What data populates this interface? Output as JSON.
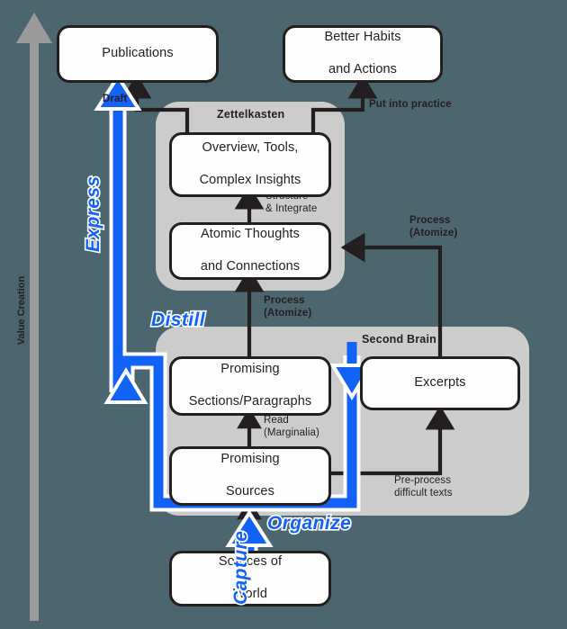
{
  "diagram": {
    "title": "Value Creation / Second Brain & Zettelkasten workflow",
    "background_color": "#4c6670",
    "panel_color": "#cccccc",
    "node_fill": "#fdfdfd",
    "stroke_color": "#231f20",
    "accent_blue": "#1162f5",
    "axis_gray": "#999999"
  },
  "axis": {
    "label": "Value Creation",
    "direction": "up"
  },
  "nodes": {
    "publications": {
      "label": "Publications"
    },
    "better_habits": {
      "line1": "Better Habits",
      "line2": "and Actions"
    },
    "overview_tools": {
      "line1": "Overview, Tools,",
      "line2": "Complex Insights"
    },
    "atomic_thoughts": {
      "line1": "Atomic Thoughts",
      "line2": "and Connections"
    },
    "promising_sections": {
      "line1": "Promising",
      "line2": "Sections/Paragraphs"
    },
    "promising_sources": {
      "line1": "Promising",
      "line2": "Sources"
    },
    "excerpts": {
      "label": "Excerpts"
    },
    "sources_of_world": {
      "line1": "Sources of",
      "line2": "World"
    }
  },
  "panels": {
    "zettelkasten": {
      "title": "Zettelkasten"
    },
    "second_brain": {
      "title": "Second Brain"
    }
  },
  "edge_labels": {
    "draft": "Draft",
    "put_into_practice": "Put into practice",
    "structure_integrate": "Structure\n& Integrate",
    "process_atomize_left": "Process\n(Atomize)",
    "process_atomize_right": "Process\n(Atomize)",
    "read_marginalia": "Read\n(Marginalia)",
    "pre_process": "Pre-process\ndifficult texts"
  },
  "code_steps": {
    "capture": "Capture",
    "organize": "Organize",
    "distill": "Distill",
    "express": "Express"
  }
}
